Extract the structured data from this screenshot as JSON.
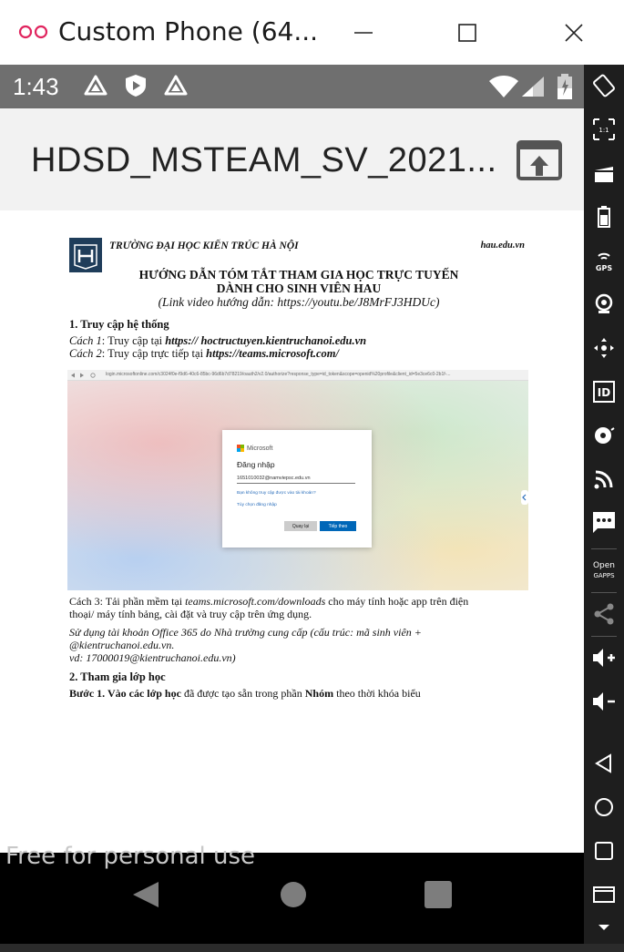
{
  "window": {
    "title": "Custom Phone (64...",
    "minimize": "—"
  },
  "status_bar": {
    "time": "1:43"
  },
  "app_bar": {
    "document_title": "HDSD_MSTEAM_SV_2021..."
  },
  "document": {
    "school_name": "TRƯỜNG ĐẠI HỌC KIẾN TRÚC HÀ NỘI",
    "website": "hau.edu.vn",
    "heading_line1": "HƯỚNG DẪN TÓM TẮT THAM GIA HỌC TRỰC TUYẾN",
    "heading_line2": "DÀNH CHO SINH VIÊN HAU",
    "video_link": "(Link video hướng dẫn: https://youtu.be/J8MrFJ3HDUc)",
    "section1_title": "1. Truy cập hệ thống",
    "way1_label": "Cách 1",
    "way1_text": ": Truy cập tại ",
    "way1_url": "https:// hoctructuyen.kientruchanoi.edu.vn",
    "way2_label": "Cách 2",
    "way2_text": ": Truy cập trực tiếp tại ",
    "way2_url": "https://teams.microsoft.com/",
    "embedded_screenshot": {
      "url": "login.microsoftonline.com/c3024f0e-f9d6-40c6-85bc-96d6b7d78219/oauth2/v2.0/authorize?response_type=id_token&scope=openid%20profile&client_id=5e3ce6c0-2b1f-...",
      "brand": "Microsoft",
      "heading": "Đăng nhập",
      "email_value": "1651010032@namviepsc.edu.vn",
      "link1": "Bạn không truy cập được vào tài khoản?",
      "link2": "Tùy chọn đăng nhập",
      "back_button": "Quay lại",
      "next_button": "Tiếp theo"
    },
    "way3_prefix": "Cách 3: Tải phần mềm tại ",
    "way3_url": "teams.microsoft.com/downloads",
    "way3_suffix": " cho máy tính hoặc app trên điện",
    "way3_line2": "thoại/ máy tính bảng, cài đặt và truy cập trên ứng dụng.",
    "account_line1": "Sử dụng tài khoản Office 365 do Nhà trường cung cấp (cấu trúc: mã sinh viên +",
    "account_line2": "@kientruchanoi.edu.vn.",
    "account_line3": "vd: 17000019@kientruchanoi.edu.vn)",
    "section2_title": "2. Tham gia lớp học",
    "step1_bold": "Bước 1. Vào các lớp học",
    "step1_text": " đã được tạo sẵn trong phần ",
    "step1_bold2": "Nhóm",
    "step1_text2": " theo thời khóa biểu"
  },
  "watermark": "Free for personal use",
  "colors": {
    "status_bar": "#6f6f6f",
    "app_bar": "#f2f2f2",
    "side_toolbar": "#1e1e1e",
    "ms_blue": "#0067b8",
    "logo_accent": "#e0245e"
  },
  "side_toolbar_icons": [
    "rotate-icon",
    "fold-icon",
    "camera-icon",
    "battery-icon",
    "gps-icon",
    "webcam-icon",
    "dpad-icon",
    "id-icon",
    "fingerprint-icon",
    "cellular-icon",
    "sms-icon",
    "open-gapps-icon",
    "share-icon",
    "volume-up-icon",
    "volume-down-icon",
    "back-icon",
    "home-icon",
    "overview-icon",
    "menu-icon",
    "expand-icon"
  ]
}
